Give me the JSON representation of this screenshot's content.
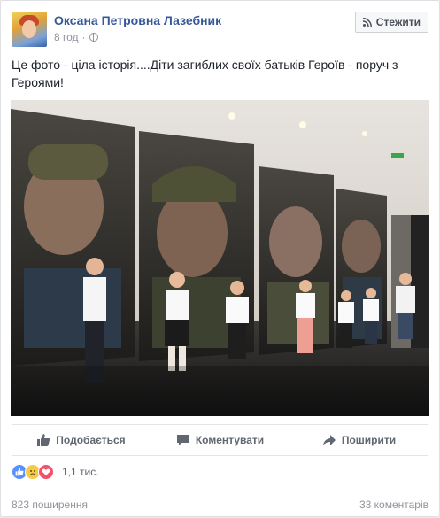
{
  "post": {
    "author": "Оксана Петровна Лазебник",
    "time": "8 год",
    "follow_label": "Стежити",
    "text": "Це фото - ціла історія....Діти загиблих своїх батьків Героїв - поруч з Героями!"
  },
  "actions": {
    "like": "Подобається",
    "comment": "Коментувати",
    "share": "Поширити"
  },
  "reactions": {
    "icons": [
      "like-icon",
      "sad-icon",
      "love-icon"
    ],
    "count": "1,1 тис."
  },
  "footer": {
    "shares": "823 поширення",
    "comments": "33 коментарів"
  },
  "colors": {
    "link": "#365899",
    "meta": "#90949c",
    "like_blue": "#5890ff",
    "love_red": "#f25268",
    "sad_yellow": "#f7c948"
  }
}
